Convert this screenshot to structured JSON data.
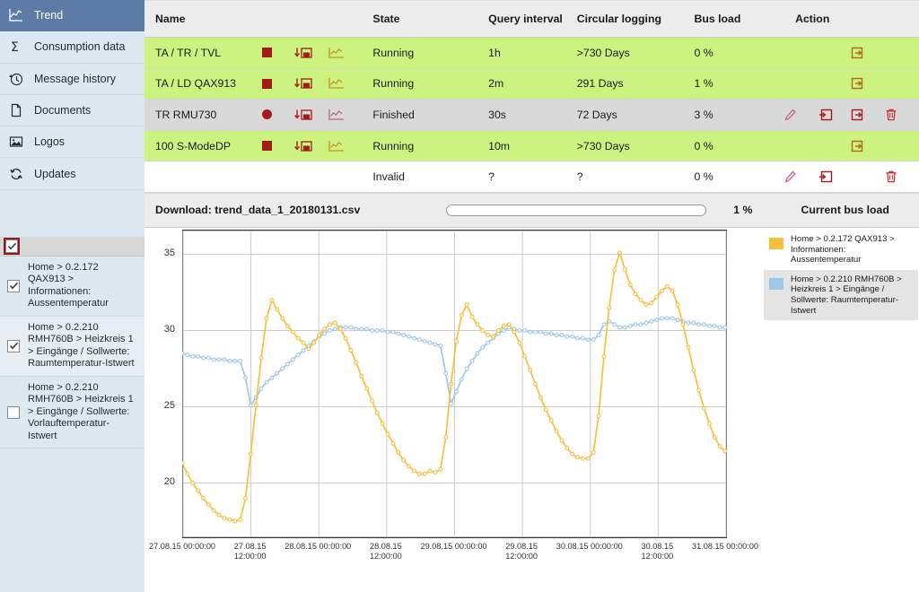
{
  "sidebar": {
    "nav": [
      {
        "label": "Trend",
        "icon": "chart-line-icon",
        "active": true
      },
      {
        "label": "Consumption data",
        "icon": "sigma-icon",
        "active": false
      },
      {
        "label": "Message history",
        "icon": "history-clock-icon",
        "active": false
      },
      {
        "label": "Documents",
        "icon": "document-icon",
        "active": false
      },
      {
        "label": "Logos",
        "icon": "image-icon",
        "active": false
      },
      {
        "label": "Updates",
        "icon": "refresh-icon",
        "active": false
      }
    ],
    "select_all_checked": true,
    "series": [
      {
        "label": "Home > 0.2.172 QAX913 > Informationen: Aussentemperatur",
        "checked": true
      },
      {
        "label": "Home > 0.2.210 RMH760B > Heizkreis 1 > Eingänge / Sollwerte: Raumtemperatur-Istwert",
        "checked": true
      },
      {
        "label": "Home > 0.2.210 RMH760B > Heizkreis 1 > Eingänge / Sollwerte: Vorlauftemperatur-Istwert",
        "checked": false
      }
    ]
  },
  "table": {
    "headers": {
      "name": "Name",
      "state": "State",
      "query_interval": "Query interval",
      "circular_logging": "Circular logging",
      "bus_load": "Bus load",
      "action": "Action"
    },
    "rows": [
      {
        "name": "TA / TR / TVL",
        "state": "Running",
        "query_interval": "1h",
        "circular_logging": ">730 Days",
        "bus_load": "0 %",
        "status_shape": "square",
        "row_style": "green",
        "actions": {
          "edit": false,
          "import": false,
          "export": true,
          "delete": false
        }
      },
      {
        "name": "TA / LD QAX913",
        "state": "Running",
        "query_interval": "2m",
        "circular_logging": "291 Days",
        "bus_load": "1 %",
        "status_shape": "square",
        "row_style": "green",
        "actions": {
          "edit": false,
          "import": false,
          "export": true,
          "delete": false
        }
      },
      {
        "name": "TR RMU730",
        "state": "Finished",
        "query_interval": "30s",
        "circular_logging": "72 Days",
        "bus_load": "3 %",
        "status_shape": "circle",
        "row_style": "gray",
        "actions": {
          "edit": true,
          "import": true,
          "export": true,
          "delete": true
        }
      },
      {
        "name": "100 S-ModeDP",
        "state": "Running",
        "query_interval": "10m",
        "circular_logging": ">730 Days",
        "bus_load": "0 %",
        "status_shape": "square",
        "row_style": "green",
        "actions": {
          "edit": false,
          "import": false,
          "export": true,
          "delete": false
        }
      },
      {
        "name": "",
        "state": "Invalid",
        "query_interval": "?",
        "circular_logging": "?",
        "bus_load": "0 %",
        "status_shape": "none",
        "row_style": "white",
        "actions": {
          "edit": true,
          "import": true,
          "export": false,
          "delete": true
        }
      }
    ]
  },
  "download_bar": {
    "prefix": "Download:",
    "filename": "trend_data_1_20180131.csv",
    "percent_label": "1 %",
    "percent_value": 1,
    "bus_load_label": "Current bus load"
  },
  "colors": {
    "series_1": "#f7c03b",
    "series_2": "#9ec8e8",
    "row_green": "#ccf380",
    "row_gray": "#d9d9d9",
    "sidebar_bg": "#dde8f0",
    "nav_active": "#5c7ba6",
    "action_icon": "#a51a1a",
    "export_icon": "#b5651d"
  },
  "chart_data": {
    "type": "line",
    "title": "",
    "xlabel": "",
    "ylabel": "",
    "ylim": [
      16.5,
      36.5
    ],
    "yticks": [
      20,
      25,
      30,
      35
    ],
    "grid": true,
    "legend_position": "right",
    "xticks": [
      "27.08.15 00:00:00",
      "27.08.15 12:00:00",
      "28.08.15 00:00:00",
      "28.08.15 12:00:00",
      "29.08.15 00:00:00",
      "29.08.15 12:00:00",
      "30.08.15 00:00:00",
      "30.08.15 12:00:00",
      "31.08.15 00:00:00"
    ],
    "xlim": [
      "27.08.15 00:00:00",
      "31.08.15 00:00:00"
    ],
    "series": [
      {
        "name": "Home > 0.2.172 QAX913 > Informationen: Aussentemperatur",
        "color": "#f7c03b",
        "values": [
          21.3,
          20.6,
          20.0,
          19.5,
          19.0,
          18.6,
          18.2,
          17.9,
          17.7,
          17.6,
          17.5,
          17.6,
          19.0,
          21.9,
          25.1,
          28.2,
          30.8,
          32.0,
          31.4,
          30.8,
          30.3,
          29.9,
          29.5,
          29.2,
          28.8,
          29.2,
          29.7,
          30.1,
          30.4,
          30.5,
          30.1,
          29.5,
          28.7,
          27.9,
          27.0,
          26.2,
          25.4,
          24.6,
          23.9,
          23.2,
          22.6,
          22.0,
          21.5,
          21.1,
          20.8,
          20.6,
          20.6,
          20.8,
          20.7,
          20.9,
          23.0,
          26.5,
          29.3,
          31.0,
          31.7,
          30.9,
          30.4,
          30.0,
          29.7,
          29.6,
          30.0,
          30.3,
          30.4,
          29.9,
          29.2,
          28.3,
          27.4,
          26.5,
          25.6,
          24.8,
          24.1,
          23.4,
          22.8,
          22.3,
          21.9,
          21.7,
          21.6,
          21.6,
          22.0,
          24.4,
          28.3,
          31.5,
          34.0,
          35.1,
          34.0,
          33.0,
          32.4,
          32.0,
          31.7,
          31.8,
          32.2,
          32.6,
          32.9,
          32.6,
          31.7,
          30.4,
          28.9,
          27.4,
          26.1,
          24.9,
          23.9,
          23.0,
          22.4,
          22.1
        ]
      },
      {
        "name": "Home > 0.2.210 RMH760B > Heizkreis 1 > Eingänge / Sollwerte: Raumtemperatur-Istwert",
        "color": "#9ec8e8",
        "values": [
          28.5,
          28.4,
          28.3,
          28.3,
          28.2,
          28.2,
          28.1,
          28.1,
          28.1,
          28.0,
          28.0,
          28.0,
          26.9,
          25.1,
          25.6,
          26.2,
          26.6,
          26.9,
          27.2,
          27.5,
          27.8,
          28.1,
          28.4,
          28.7,
          29.0,
          29.3,
          29.6,
          29.8,
          30.0,
          30.1,
          30.2,
          30.2,
          30.2,
          30.1,
          30.1,
          30.1,
          30.0,
          30.0,
          30.0,
          29.9,
          29.9,
          29.8,
          29.7,
          29.6,
          29.5,
          29.4,
          29.3,
          29.2,
          29.1,
          29.0,
          27.2,
          25.2,
          26.0,
          26.8,
          27.5,
          28.0,
          28.5,
          28.9,
          29.2,
          29.5,
          29.8,
          30.0,
          30.2,
          30.1,
          30.0,
          30.0,
          29.9,
          29.9,
          29.9,
          29.8,
          29.8,
          29.7,
          29.7,
          29.6,
          29.6,
          29.5,
          29.5,
          29.4,
          29.4,
          29.7,
          30.4,
          30.6,
          30.4,
          30.2,
          30.2,
          30.3,
          30.4,
          30.4,
          30.5,
          30.6,
          30.7,
          30.8,
          30.8,
          30.8,
          30.7,
          30.6,
          30.5,
          30.5,
          30.4,
          30.4,
          30.3,
          30.3,
          30.2,
          30.2
        ]
      }
    ]
  }
}
